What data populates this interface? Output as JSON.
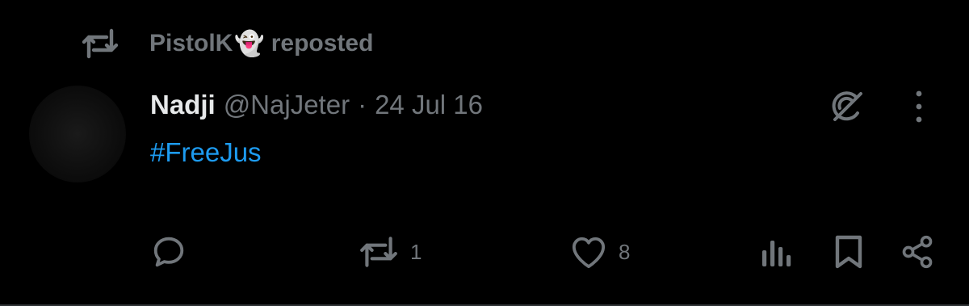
{
  "repost": {
    "user": "PistolK",
    "emoji": "👻",
    "label": "reposted",
    "icon": "repost-icon"
  },
  "tweet": {
    "display_name": "Nadji",
    "handle": "@NajJeter",
    "separator": "·",
    "date": "24 Jul 16",
    "text": "#FreeJus"
  },
  "actions": {
    "reply": {
      "icon": "reply-icon",
      "count": ""
    },
    "repost": {
      "icon": "repost-icon",
      "count": "1"
    },
    "like": {
      "icon": "heart-icon",
      "count": "8"
    },
    "views": {
      "icon": "analytics-icon"
    },
    "bookmark": {
      "icon": "bookmark-icon"
    },
    "share": {
      "icon": "share-icon"
    }
  },
  "colors": {
    "background": "#000000",
    "primary_text": "#e7e9ea",
    "secondary_text": "#71767b",
    "link": "#1d9bf0"
  }
}
